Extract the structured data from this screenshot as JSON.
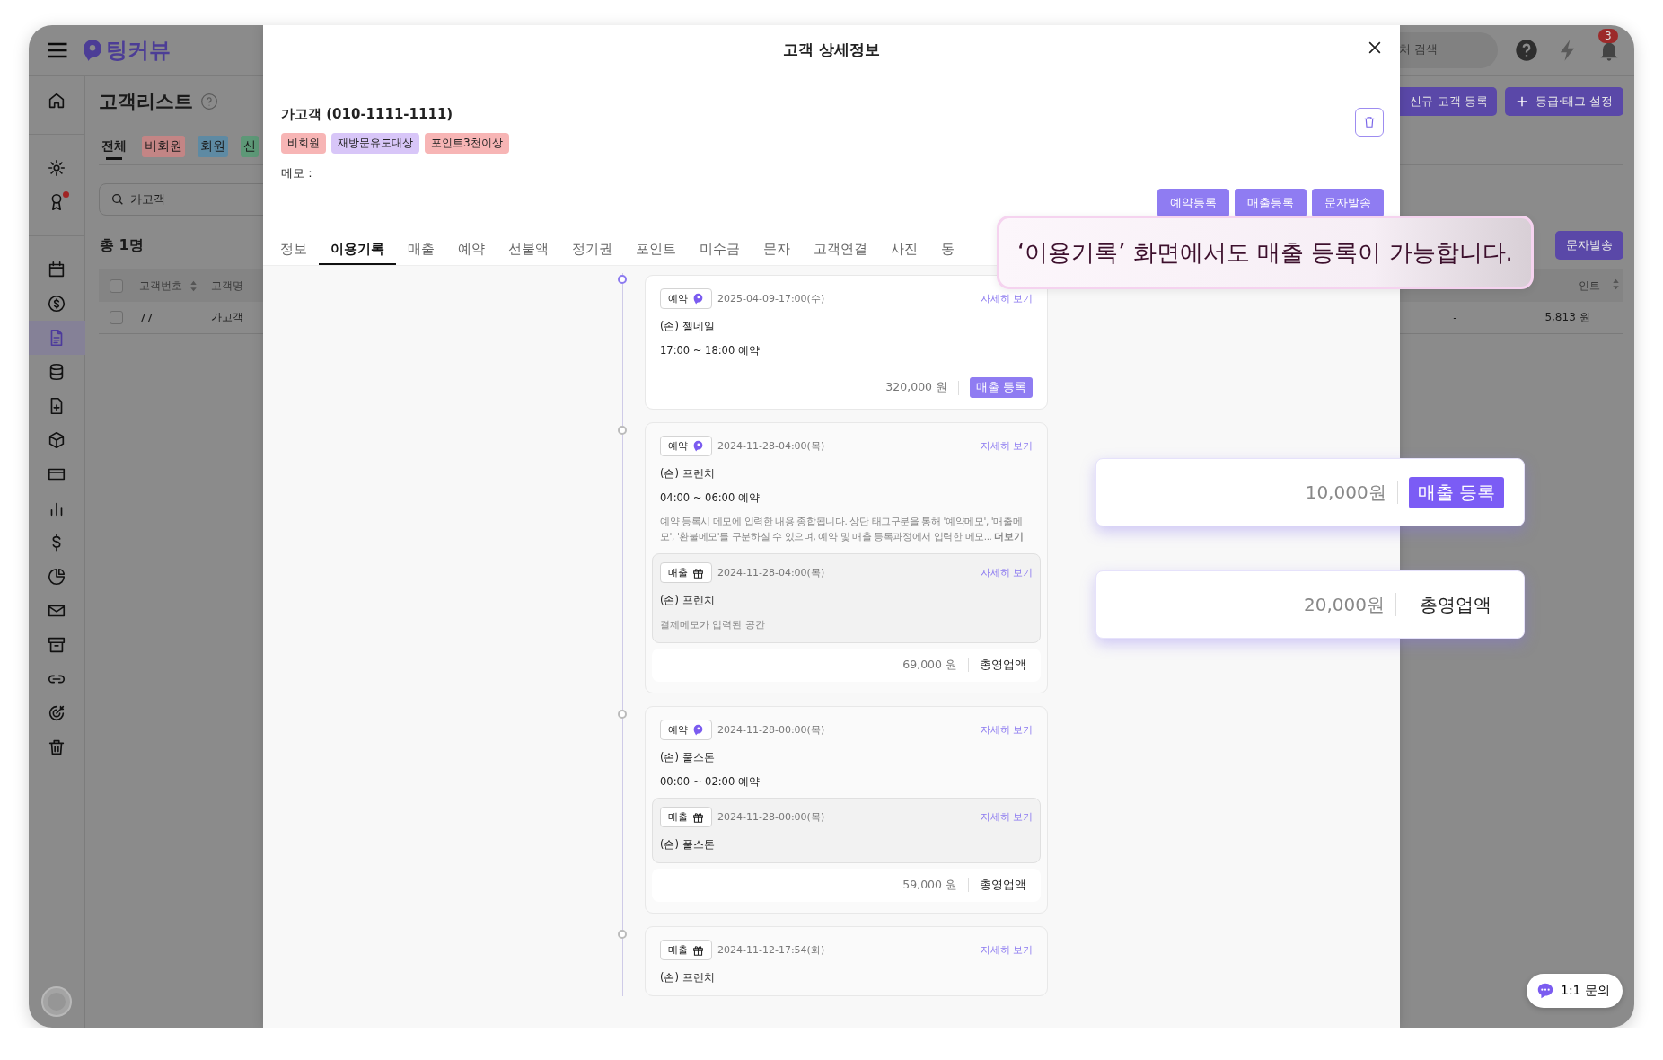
{
  "app": {
    "logo": "팅커뷰",
    "search": {
      "placeholder": "처 검색"
    },
    "notification_count": "3",
    "sidebar": {
      "items": [
        {
          "selected": false,
          "alert": false
        },
        {
          "selected": false,
          "alert": false
        },
        {
          "selected": false,
          "alert": true
        },
        {
          "selected": false,
          "alert": false
        },
        {
          "selected": false,
          "alert": false
        },
        {
          "selected": true,
          "alert": false
        },
        {
          "selected": false,
          "alert": false
        },
        {
          "selected": false,
          "alert": false
        },
        {
          "selected": false,
          "alert": false
        },
        {
          "selected": false,
          "alert": false
        },
        {
          "selected": false,
          "alert": false
        },
        {
          "selected": false,
          "alert": false
        },
        {
          "selected": false,
          "alert": false
        },
        {
          "selected": false,
          "alert": false
        },
        {
          "selected": false,
          "alert": false
        },
        {
          "selected": false,
          "alert": false
        },
        {
          "selected": false,
          "alert": false
        },
        {
          "selected": false,
          "alert": false
        }
      ]
    },
    "page": {
      "title": "고객리스트",
      "actions": [
        {
          "label": "신규 고객 등록",
          "kind": "plain"
        },
        {
          "label": "등급·태그 설정",
          "kind": "add"
        }
      ],
      "tabs": [
        {
          "label": "전체",
          "selected": true
        },
        {
          "label": "비회원",
          "selected": false,
          "color": "#c38585"
        },
        {
          "label": "회원",
          "selected": false,
          "color": "#5e8aa3"
        },
        {
          "label": "신",
          "selected": false,
          "color": "#5d9877"
        }
      ],
      "search": {
        "value": "가고객"
      },
      "total": "총 1명",
      "send_button": "문자발송",
      "table": {
        "all_checked": false,
        "columns": [
          {
            "label": "고객번호",
            "sortable": true
          },
          {
            "label": "고객명",
            "sortable": false
          }
        ],
        "columns_right": [
          {
            "label": "인트",
            "sortable": true
          }
        ],
        "rows": [
          {
            "checked": false,
            "cells": [
              "77",
              "가고객"
            ],
            "cells_right": [
              "-",
              "5,813 원"
            ]
          }
        ]
      }
    }
  },
  "modal": {
    "title": "고객 상세정보",
    "customer": "가고객 (010-1111-1111)",
    "tags": [
      {
        "label": "비회원",
        "color": "#f7b5b5"
      },
      {
        "label": "재방문유도대상",
        "color": "#d8c6f8"
      },
      {
        "label": "포인트3천이상",
        "color": "#f7b5b5"
      }
    ],
    "memo_label": "메모 :",
    "actions": [
      "예약등록",
      "매출등록",
      "문자발송"
    ],
    "tabs": [
      {
        "label": "정보",
        "selected": false
      },
      {
        "label": "이용기록",
        "selected": true
      },
      {
        "label": "매출",
        "selected": false
      },
      {
        "label": "예약",
        "selected": false
      },
      {
        "label": "선불액",
        "selected": false
      },
      {
        "label": "정기권",
        "selected": false
      },
      {
        "label": "포인트",
        "selected": false
      },
      {
        "label": "미수금",
        "selected": false
      },
      {
        "label": "문자",
        "selected": false
      },
      {
        "label": "고객연결",
        "selected": false
      },
      {
        "label": "사진",
        "selected": false
      },
      {
        "label": "동",
        "selected": false
      }
    ],
    "timeline": [
      {
        "active": true,
        "kind": "reservation",
        "badge": "예약",
        "date": "2025-04-09-17:00(수)",
        "link": "자세히 보기",
        "lines": [
          "(손) 젤네일",
          "17:00 ~ 18:00 예약"
        ],
        "footer": {
          "amount": "320,000 원",
          "action": "매출 등록",
          "kind": "button"
        }
      },
      {
        "active": false,
        "kind": "reservation",
        "badge": "예약",
        "date": "2024-11-28-04:00(목)",
        "link": "자세히 보기",
        "lines": [
          "(손) 프렌치",
          "04:00 ~ 06:00 예약"
        ],
        "memo": "예약 등록시 메모에 입력한 내용 종합됩니다. 상단 태그구분을 통해 '예약메모', '매출메모', '환불메모'를 구분하실 수 있으며, 예약 및 매출 등록과정에서 입력한 메모... **더보기**",
        "sub": {
          "kind": "sale",
          "badge": "매출",
          "date": "2024-11-28-04:00(목)",
          "link": "자세히 보기",
          "lines": [
            "(손) 프렌치"
          ],
          "note": "결제메모가 입력된 공간"
        },
        "footer": {
          "amount": "69,000 원",
          "action": "총영업액",
          "kind": "label"
        }
      },
      {
        "active": false,
        "kind": "reservation",
        "badge": "예약",
        "date": "2024-11-28-00:00(목)",
        "link": "자세히 보기",
        "lines": [
          "(손) 풀스톤",
          "00:00 ~ 02:00 예약"
        ],
        "sub": {
          "kind": "sale",
          "badge": "매출",
          "date": "2024-11-28-00:00(목)",
          "link": "자세히 보기",
          "lines": [
            "(손) 풀스톤"
          ]
        },
        "footer": {
          "amount": "59,000 원",
          "action": "총영업액",
          "kind": "label"
        }
      },
      {
        "active": false,
        "kind": "sale",
        "badge": "매출",
        "date": "2024-11-12-17:54(화)",
        "link": "자세히 보기",
        "lines": [
          "(손) 프렌치"
        ]
      }
    ]
  },
  "callout": {
    "text": "‘이용기록’ 화면에서도 매출 등록이 가능합니다."
  },
  "examples": [
    {
      "amount": "10,000원",
      "action": "매출 등록",
      "kind": "button"
    },
    {
      "amount": "20,000원",
      "action": "총영업액",
      "kind": "label"
    }
  ],
  "chat_button": {
    "label": "1:1 문의"
  }
}
